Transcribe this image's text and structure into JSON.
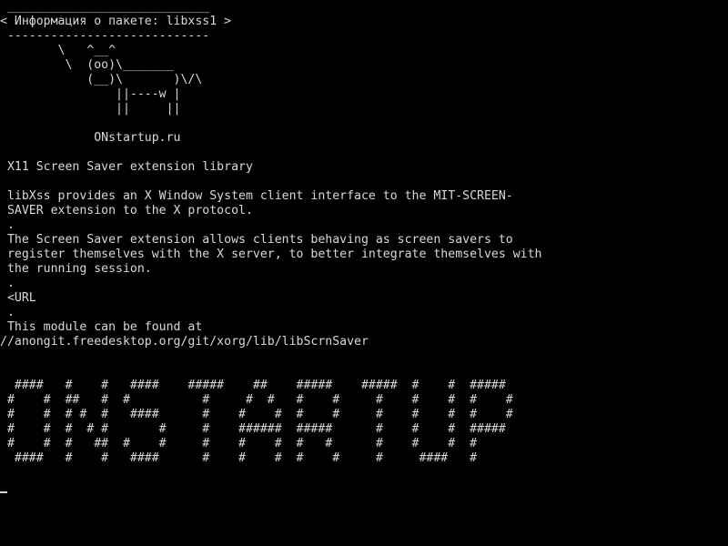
{
  "terminal": {
    "lines": [
      " ____________________________",
      "< Информация о пакете: libxss1 >",
      " ----------------------------",
      "        \\   ^__^",
      "         \\  (oo)\\_______",
      "            (__)\\       )\\/\\",
      "                ||----w |",
      "                ||     ||",
      "",
      "             ONstartup.ru",
      "",
      " X11 Screen Saver extension library",
      "",
      " libXss provides an X Window System client interface to the MIT-SCREEN-",
      " SAVER extension to the X protocol.",
      " .",
      " The Screen Saver extension allows clients behaving as screen savers to",
      " register themselves with the X server, to better integrate themselves with",
      " the running session.",
      " .",
      " <URL",
      " .",
      " This module can be found at",
      "//anongit.freedesktop.org/git/xorg/lib/libScrnSaver",
      "",
      "",
      "  ####   #    #   ####    #####    ##    #####    #####  #    #  #####",
      " #    #  ##   #  #          #     #  #   #    #     #    #    #  #    #",
      " #    #  # #  #   ####      #    #    #  #    #     #    #    #  #    #",
      " #    #  #  # #       #     #    ######  #####      #    #    #  #####",
      " #    #  #   ##  #    #     #    #    #  #   #      #    #    #  #",
      "  ####   #    #   ####      #    #    #  #    #     #     ####   #"
    ]
  }
}
